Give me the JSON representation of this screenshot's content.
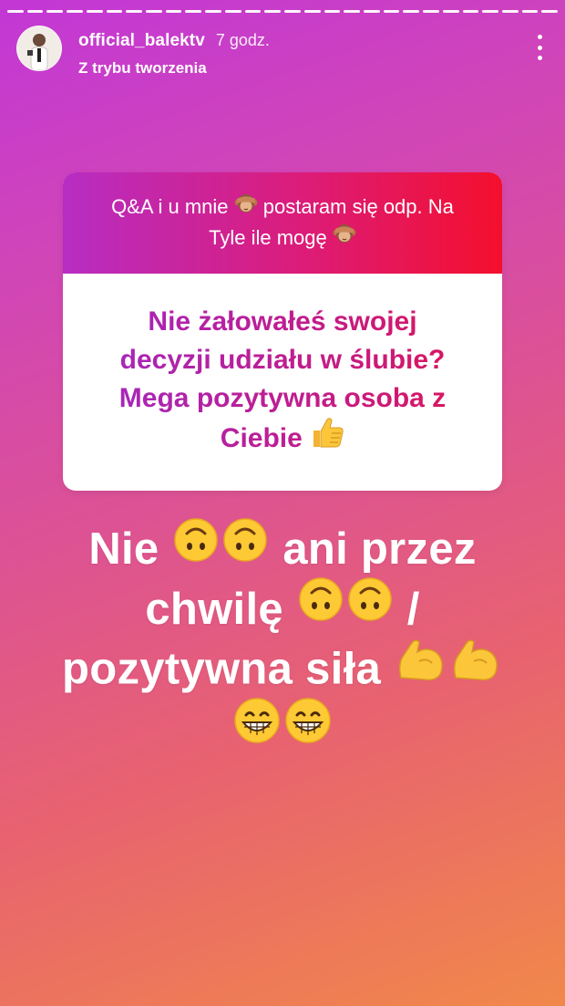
{
  "story": {
    "segments": 28
  },
  "header": {
    "username": "official_balektv",
    "time": "7 godz.",
    "subtitle": "Z trybu tworzenia"
  },
  "qa": {
    "prompt_line1": "Q&A i u mnie",
    "prompt_line1b": "postaram się odp. Na",
    "prompt_line2": "Tyle ile mogę",
    "question_line1": "Nie żałowałeś swojej",
    "question_line2": "decyzji udziału w ślubie?",
    "question_line3": "Mega pozytywna osoba z",
    "question_line4": "Ciebie"
  },
  "answer": {
    "word1": "Nie",
    "word2": "ani przez",
    "word3": "chwilę",
    "word4": "/",
    "word5": "pozytywna siła"
  },
  "icons": {
    "monkey": "see-no-evil-monkey-icon",
    "thumb": "thumbs-up-icon",
    "upside": "upside-down-face-icon",
    "muscle": "flexed-biceps-icon",
    "grin": "grinning-face-icon"
  },
  "colors": {
    "card_header_start": "#b72dc3",
    "card_header_end": "#f40f2d",
    "question_text": "#b0229f"
  }
}
